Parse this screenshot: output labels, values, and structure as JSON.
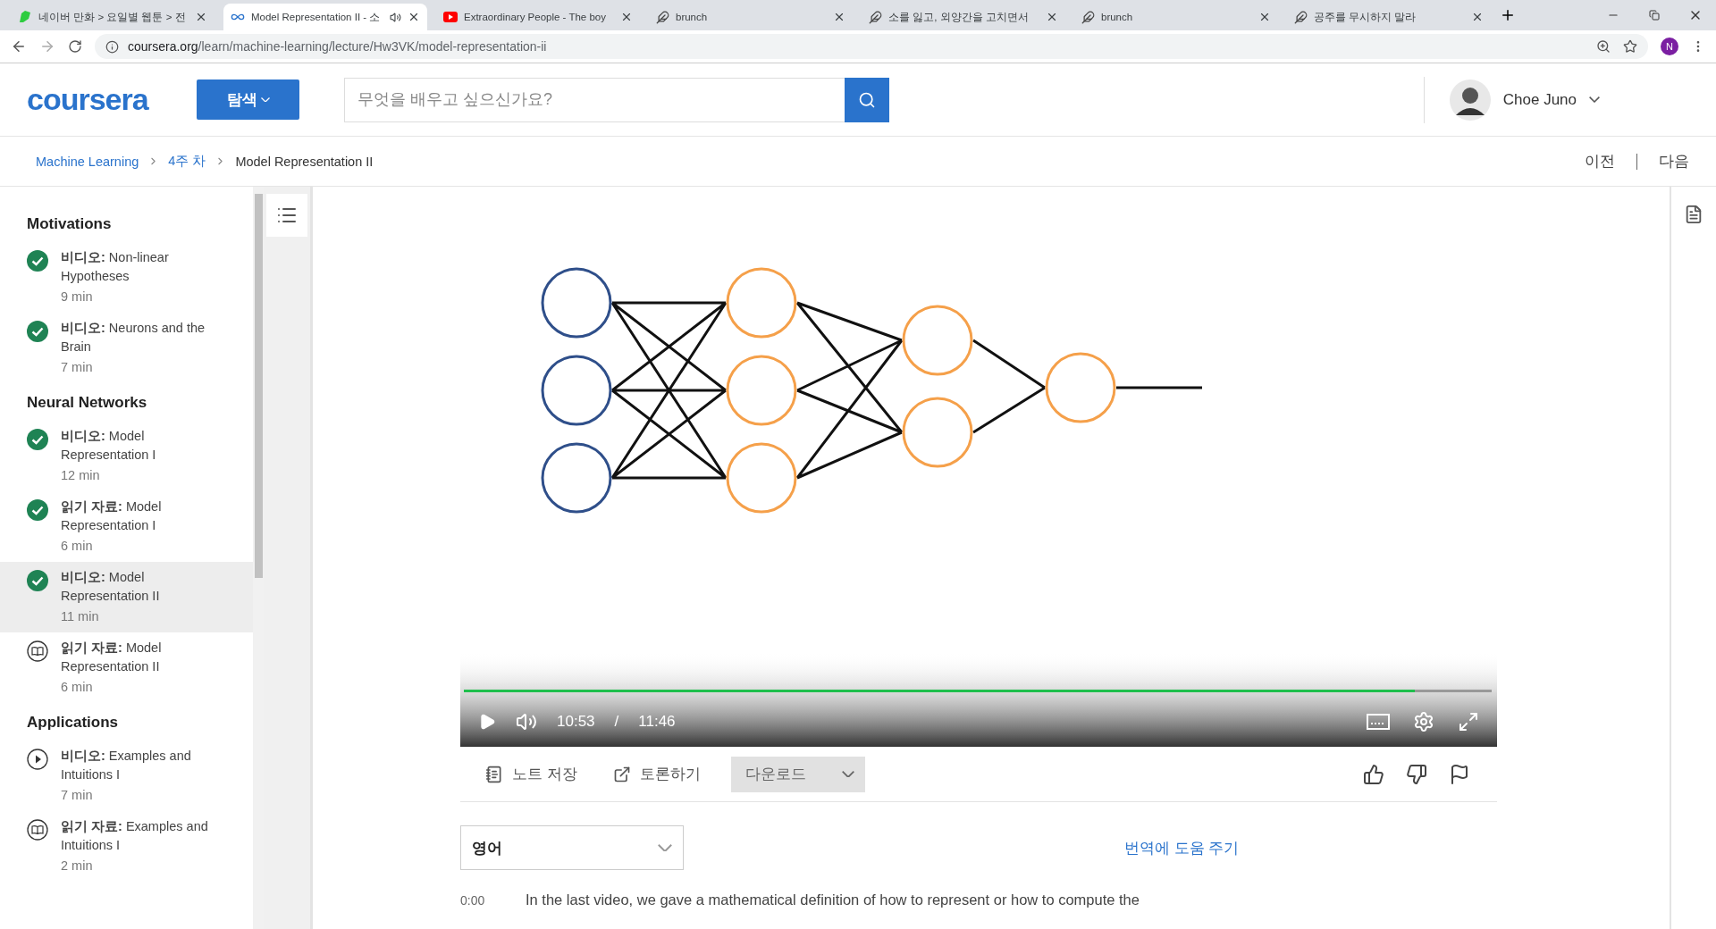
{
  "browser": {
    "tabs": [
      {
        "title": "네이버 만화 > 요일별 웹툰 > 전",
        "kind": "leaf",
        "selected": false,
        "audio": false
      },
      {
        "title": "Model Representation II - 소",
        "kind": "loop",
        "selected": true,
        "audio": true
      },
      {
        "title": "Extraordinary People - The boy",
        "kind": "video",
        "selected": false,
        "audio": false
      },
      {
        "title": "brunch",
        "kind": "pen",
        "selected": false,
        "audio": false
      },
      {
        "title": "소를 잃고, 외양간을 고치면서",
        "kind": "pen",
        "selected": false,
        "audio": false
      },
      {
        "title": "brunch",
        "kind": "pen",
        "selected": false,
        "audio": false
      },
      {
        "title": "공주를 무시하지 말라",
        "kind": "pen",
        "selected": false,
        "audio": false
      }
    ],
    "address": {
      "host": "coursera.org",
      "path": "/learn/machine-learning/lecture/Hw3VK/model-representation-ii"
    },
    "profile_initial": "N"
  },
  "header": {
    "logo": "coursera",
    "explore_button": "탐색",
    "search": {
      "placeholder": "무엇을 배우고 싶으신가요?"
    },
    "user": {
      "name": "Choe Juno"
    }
  },
  "breadcrumb": [
    {
      "label": "Machine Learning",
      "kind": "link"
    },
    {
      "label": "4주 차",
      "kind": "link"
    },
    {
      "label": "Model Representation II",
      "kind": "current"
    }
  ],
  "lesson_nav": {
    "previous": "이전",
    "next": "다음"
  },
  "sidebar": {
    "sections": [
      {
        "title": "Motivations",
        "items": [
          {
            "label": "**비디오:** Non-linear Hypotheses",
            "duration": "9 min",
            "completed": true,
            "selected": false
          },
          {
            "label": "**비디오:** Neurons and the Brain",
            "duration": "7 min",
            "completed": true,
            "selected": false
          }
        ]
      },
      {
        "title": "Neural Networks",
        "items": [
          {
            "label": "**비디오:** Model Representation I",
            "duration": "12 min",
            "completed": true,
            "selected": false
          },
          {
            "label": "**읽기 자료:** Model Representation I",
            "duration": "6 min",
            "completed": true,
            "selected": false
          },
          {
            "label": "**비디오:** Model Representation II",
            "duration": "11 min",
            "completed": true,
            "selected": true
          },
          {
            "label": "**읽기 자료:** Model Representation II",
            "duration": "6 min",
            "kind": "reading",
            "completed": false,
            "selected": false
          }
        ]
      },
      {
        "title": "Applications",
        "items": [
          {
            "label": "**비디오:** Examples and Intuitions I",
            "duration": "7 min",
            "kind": "video",
            "completed": false,
            "selected": false
          },
          {
            "label": "**읽기 자료:** Examples and Intuitions I",
            "duration": "2 min",
            "kind": "reading",
            "completed": false,
            "selected": false
          }
        ]
      }
    ]
  },
  "video": {
    "kind": "picture",
    "current_time": "10:53",
    "separator": "/",
    "duration": "11:46",
    "level": 0.925
  },
  "actions": {
    "save_note": "노트 저장",
    "discuss": "토론하기",
    "download": "다운로드"
  },
  "transcript": {
    "language": "영어",
    "help_link": "번역에 도움 주기",
    "lines": [
      {
        "time": "0:00",
        "text": "In the last video, we gave a mathematical definition of how to represent or how to compute the"
      }
    ]
  }
}
